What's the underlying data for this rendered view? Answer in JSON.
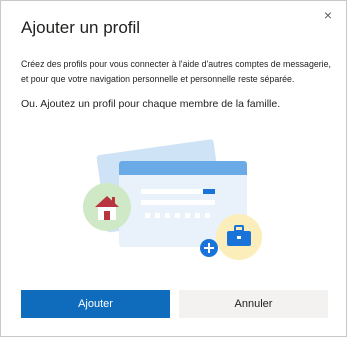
{
  "dialog": {
    "title": "Ajouter un profil",
    "close_glyph": "×",
    "description_line1": "Créez des profils pour vous connecter à l'aide d'autres comptes de messagerie, et pour que votre navigation personnelle et personnelle reste séparée.",
    "description_line2": "Ou. Ajoutez un profil pour chaque membre de la famille.",
    "add_button_label": "Ajouter",
    "cancel_button_label": "Annuler"
  },
  "colors": {
    "primary": "#0f6cbd",
    "secondary_button": "#f3f2f1"
  },
  "icons": {
    "close": "close-icon",
    "illustration": "profile-illustration",
    "home": "home-icon",
    "briefcase": "briefcase-icon",
    "add": "plus-circle-icon"
  }
}
